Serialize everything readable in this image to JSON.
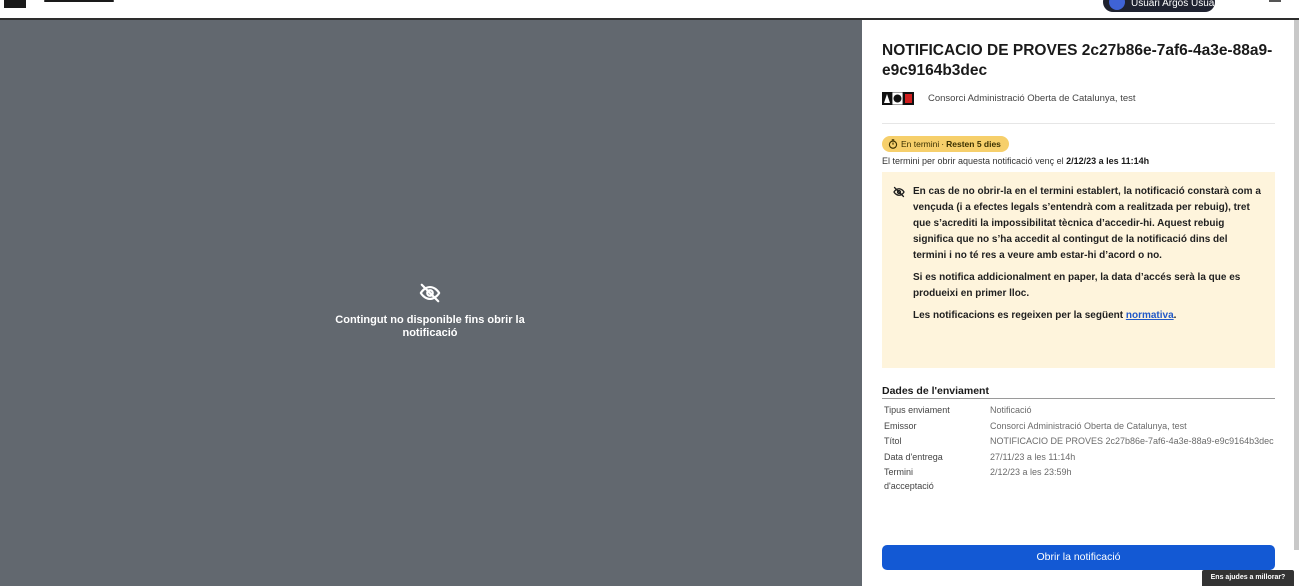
{
  "header": {
    "user_name": "Usuari Argos Usuari"
  },
  "preview": {
    "unavailable_message": "Contingut no disponible fins obrir la notificació",
    "icon": "eye-off-icon"
  },
  "notification": {
    "title": "NOTIFICACIO DE PROVES 2c27b86e-7af6-4a3e-88a9-e9c9164b3dec",
    "organization": "Consorci Administració Oberta de Catalunya, test"
  },
  "status": {
    "badge_label": "En termini",
    "badge_separator": "·",
    "badge_remaining": "Resten 5 dies",
    "badge_color": "#f6cf6b",
    "deadline_prefix": "El termini per obrir aquesta notificació venç el ",
    "deadline_value": "2/12/23 a les 11:14h"
  },
  "warning": {
    "paragraph_1": "En cas de no obrir-la en el termini establert, la notificació constarà com a vençuda (i a efectes legals s’entendrà com a realitzada per rebuig), tret que s’acrediti la impossibilitat tècnica d’accedir-hi. Aquest rebuig significa que no s’ha accedit al contingut de la notificació dins del termini i no té res a veure amb estar-hi d’acord o no.",
    "paragraph_2": "Si es notifica addicionalment en paper, la data d’accés serà la que es produeixi en primer lloc.",
    "paragraph_3_prefix": "Les notificacions es regeixen per la següent ",
    "paragraph_3_link": "normativa",
    "paragraph_3_suffix": ".",
    "background_color": "#fef4dc"
  },
  "details": {
    "title": "Dades de l'enviament",
    "rows": [
      {
        "label": "Tipus enviament",
        "value": "Notificació"
      },
      {
        "label": "Emissor",
        "value": "Consorci Administració Oberta de Catalunya, test"
      },
      {
        "label": "Títol",
        "value": "NOTIFICACIO DE PROVES 2c27b86e-7af6-4a3e-88a9-e9c9164b3dec"
      },
      {
        "label": "Data d'entrega",
        "value": "27/11/23 a les 11:14h"
      },
      {
        "label": "Termini d'acceptació",
        "value": "2/12/23 a les 23:59h"
      }
    ]
  },
  "actions": {
    "open_button": "Obrir la notificació",
    "primary_color": "#1359d4"
  },
  "feedback": {
    "label": "Ens ajudes a millorar?"
  }
}
